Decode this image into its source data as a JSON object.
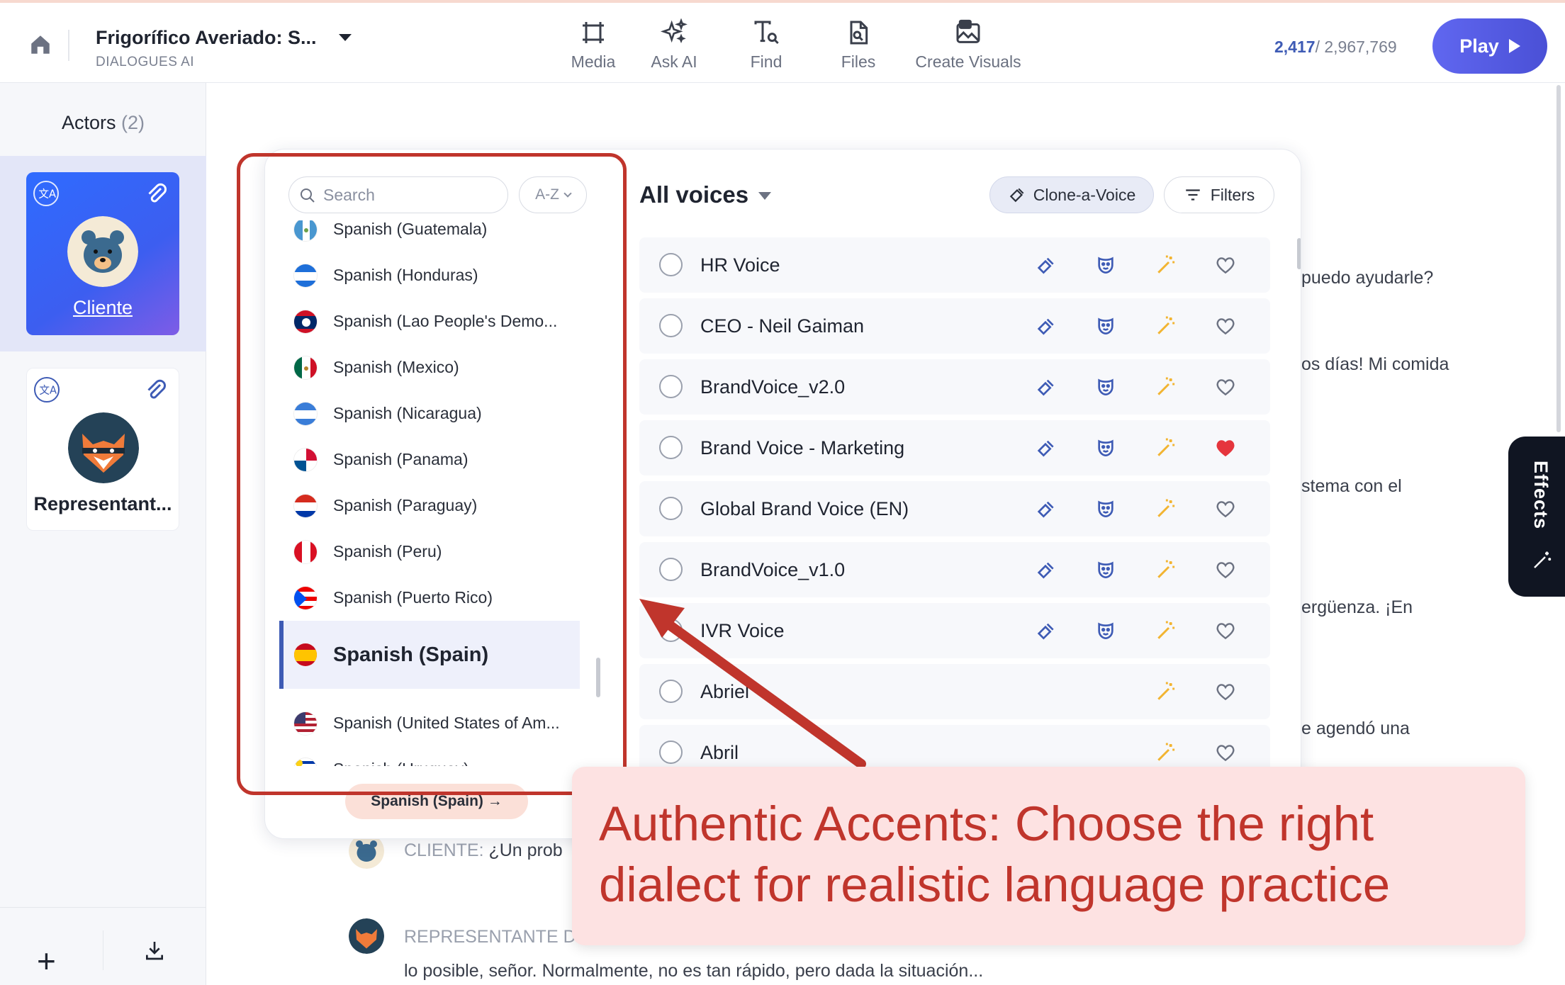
{
  "header": {
    "project_title": "Frigorífico Averiado: S...",
    "project_subtitle": "DIALOGUES AI",
    "tools": [
      {
        "label": "Media",
        "icon": "media-frame-icon"
      },
      {
        "label": "Ask AI",
        "icon": "sparkles-icon"
      },
      {
        "label": "Find",
        "icon": "find-text-icon"
      },
      {
        "label": "Files",
        "icon": "file-search-icon"
      },
      {
        "label": "Create Visuals",
        "icon": "image-create-icon"
      }
    ],
    "count_used": "2,417",
    "count_total": "/ 2,967,769",
    "play_label": "Play"
  },
  "sidebar": {
    "actors_label": "Actors",
    "actors_count": "(2)",
    "actors": [
      {
        "name": "Cliente",
        "avatar": "bear-avatar",
        "selected": true
      },
      {
        "name": "Representant...",
        "avatar": "fox-avatar",
        "selected": false
      }
    ]
  },
  "script_lines": [
    {
      "text": "puedo ayudarle?"
    },
    {
      "text": "os días! Mi comida"
    },
    {
      "text": "stema con el"
    },
    {
      "text": "ergüenza. ¡En"
    },
    {
      "text": "e agendó una"
    },
    {
      "speaker": "CLIENTE:",
      "text": " ¿Un prob"
    },
    {
      "speaker": "REPRESENTANTE D",
      "text": ""
    },
    {
      "text": "lo posible, señor. Normalmente, no es tan rápido, pero dada la situación..."
    }
  ],
  "effects_label": "Effects",
  "language_picker": {
    "search_placeholder": "Search",
    "sort_label": "A-Z",
    "languages": [
      {
        "label": "Spanish (Guatemala)",
        "flag": "gt"
      },
      {
        "label": "Spanish (Honduras)",
        "flag": "hn"
      },
      {
        "label": "Spanish (Lao People's Demo...",
        "flag": "la"
      },
      {
        "label": "Spanish (Mexico)",
        "flag": "mx"
      },
      {
        "label": "Spanish (Nicaragua)",
        "flag": "ni"
      },
      {
        "label": "Spanish (Panama)",
        "flag": "pa"
      },
      {
        "label": "Spanish (Paraguay)",
        "flag": "py"
      },
      {
        "label": "Spanish (Peru)",
        "flag": "pe"
      },
      {
        "label": "Spanish (Puerto Rico)",
        "flag": "pr"
      },
      {
        "label": "Spanish (Spain)",
        "flag": "es",
        "selected": true
      },
      {
        "label": "Spanish (United States of Am...",
        "flag": "us"
      },
      {
        "label": "Spanish (Uruguay)",
        "flag": "uy"
      }
    ],
    "selected_chip": "Spanish (Spain)"
  },
  "voices_panel": {
    "title": "All voices",
    "clone_label": "Clone-a-Voice",
    "filters_label": "Filters",
    "voices": [
      {
        "name": "HR Voice",
        "favorite": false,
        "cloned": true
      },
      {
        "name": "CEO - Neil Gaiman",
        "favorite": false,
        "cloned": true
      },
      {
        "name": "BrandVoice_v2.0",
        "favorite": false,
        "cloned": true
      },
      {
        "name": "Brand Voice - Marketing",
        "favorite": true,
        "cloned": true
      },
      {
        "name": "Global Brand Voice (EN)",
        "favorite": false,
        "cloned": true
      },
      {
        "name": "BrandVoice_v1.0",
        "favorite": false,
        "cloned": true
      },
      {
        "name": "IVR Voice",
        "favorite": false,
        "cloned": true
      },
      {
        "name": "Abriel",
        "favorite": false,
        "cloned": false
      },
      {
        "name": "Abril",
        "favorite": false,
        "cloned": false
      }
    ]
  },
  "annotation": {
    "callout_text": "Authentic Accents: Choose the right dialect for realistic language practice",
    "color": "#c0352c"
  },
  "colors": {
    "accent": "#3e5bb5",
    "play_button": "#5a60e8",
    "favorite": "#e5353d",
    "wand": "#f2b431"
  }
}
